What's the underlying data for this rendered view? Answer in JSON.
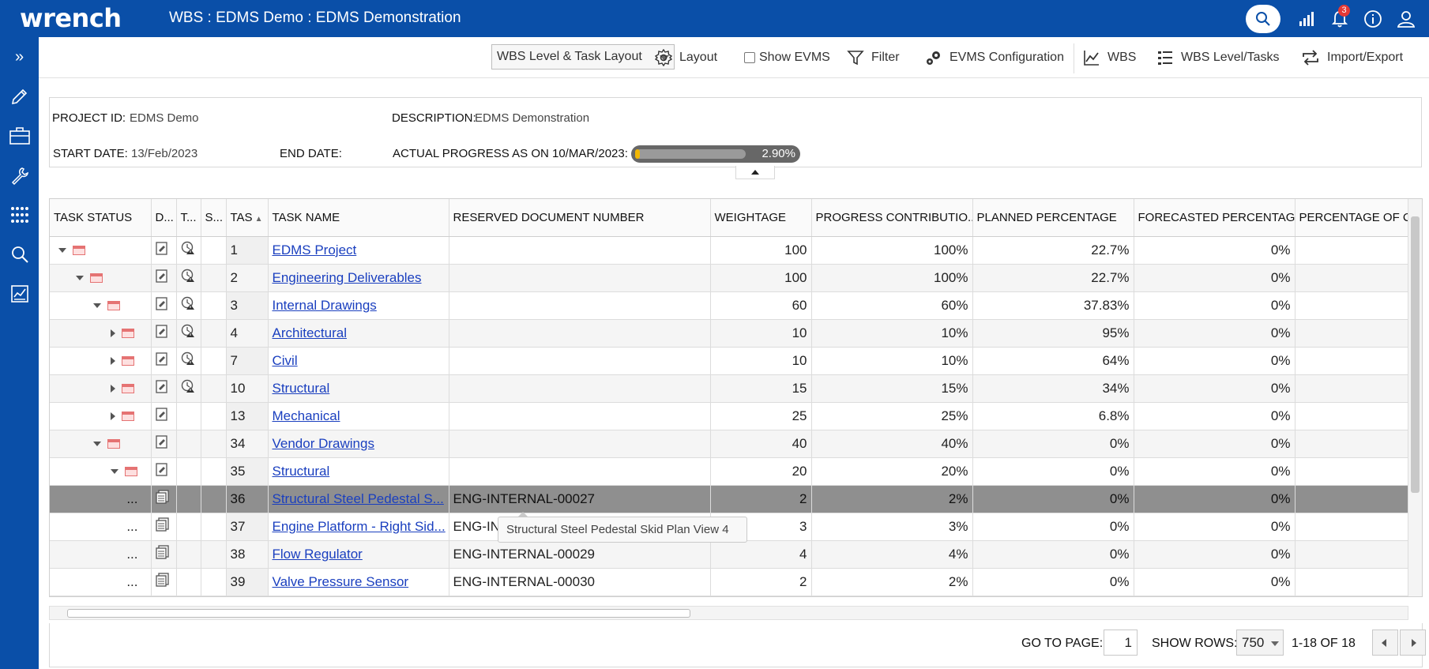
{
  "header": {
    "logo": "wrench",
    "title": "WBS : EDMS Demo : EDMS Demonstration",
    "notification_count": "3",
    "icons": [
      "search-icon",
      "signal-icon",
      "bell-icon",
      "info-icon",
      "user-icon"
    ]
  },
  "sidebar": {
    "expand_label": "»",
    "items": [
      "pencil-icon",
      "briefcase-icon",
      "wrench-icon",
      "grid-icon",
      "search-icon",
      "report-icon"
    ]
  },
  "toolbar": {
    "layout_select": "WBS Level & Task Layout",
    "layout_label": "Layout",
    "show_evms_label": "Show EVMS",
    "filter_label": "Filter",
    "evms_config_label": "EVMS Configuration",
    "wbs_label": "WBS",
    "wbs_level_tasks_label": "WBS Level/Tasks",
    "import_export_label": "Import/Export"
  },
  "project": {
    "project_id_label": "PROJECT ID:",
    "project_id": "EDMS Demo",
    "description_label": "DESCRIPTION:",
    "description": "EDMS Demonstration",
    "start_date_label": "START DATE:",
    "start_date": "13/Feb/2023",
    "end_date_label": "END DATE:",
    "end_date": "",
    "progress_label": "ACTUAL PROGRESS AS ON 10/MAR/2023:",
    "progress_text": "2.90%",
    "progress_value": 0.029
  },
  "grid": {
    "columns": {
      "task_status": "TASK STATUS",
      "d": "D...",
      "t": "T...",
      "s": "S...",
      "task_id": "TAS",
      "task_name": "TASK NAME",
      "reserved_doc": "RESERVED DOCUMENT NUMBER",
      "weightage": "WEIGHTAGE",
      "progress_contribution": "PROGRESS CONTRIBUTIO...",
      "planned": "PLANNED PERCENTAGE",
      "forecasted": "FORECASTED PERCENTAGE",
      "percentage_of": "PERCENTAGE OF C"
    },
    "rows": [
      {
        "id": "1",
        "name": "EDMS Project",
        "doc": "",
        "weight": "100",
        "contrib": "100%",
        "planned": "22.7%",
        "forecast": "0%"
      },
      {
        "id": "2",
        "name": "Engineering Deliverables",
        "doc": "",
        "weight": "100",
        "contrib": "100%",
        "planned": "22.7%",
        "forecast": "0%"
      },
      {
        "id": "3",
        "name": "Internal Drawings",
        "doc": "",
        "weight": "60",
        "contrib": "60%",
        "planned": "37.83%",
        "forecast": "0%"
      },
      {
        "id": "4",
        "name": "Architectural",
        "doc": "",
        "weight": "10",
        "contrib": "10%",
        "planned": "95%",
        "forecast": "0%"
      },
      {
        "id": "7",
        "name": "Civil",
        "doc": "",
        "weight": "10",
        "contrib": "10%",
        "planned": "64%",
        "forecast": "0%"
      },
      {
        "id": "10",
        "name": "Structural",
        "doc": "",
        "weight": "15",
        "contrib": "15%",
        "planned": "34%",
        "forecast": "0%"
      },
      {
        "id": "13",
        "name": "Mechanical",
        "doc": "",
        "weight": "25",
        "contrib": "25%",
        "planned": "6.8%",
        "forecast": "0%"
      },
      {
        "id": "34",
        "name": "Vendor Drawings",
        "doc": "",
        "weight": "40",
        "contrib": "40%",
        "planned": "0%",
        "forecast": "0%"
      },
      {
        "id": "35",
        "name": "Structural",
        "doc": "",
        "weight": "20",
        "contrib": "20%",
        "planned": "0%",
        "forecast": "0%"
      },
      {
        "id": "36",
        "name": "Structural Steel Pedestal S...",
        "doc": "ENG-INTERNAL-00027",
        "weight": "2",
        "contrib": "2%",
        "planned": "0%",
        "forecast": "0%",
        "status": "..."
      },
      {
        "id": "37",
        "name": "Engine Platform - Right Sid...",
        "doc": "ENG-IN",
        "weight": "3",
        "contrib": "3%",
        "planned": "0%",
        "forecast": "0%",
        "status": "..."
      },
      {
        "id": "38",
        "name": "Flow Regulator",
        "doc": "ENG-INTERNAL-00029",
        "weight": "4",
        "contrib": "4%",
        "planned": "0%",
        "forecast": "0%",
        "status": "..."
      },
      {
        "id": "39",
        "name": "Valve Pressure Sensor",
        "doc": "ENG-INTERNAL-00030",
        "weight": "2",
        "contrib": "2%",
        "planned": "0%",
        "forecast": "0%",
        "status": "..."
      }
    ]
  },
  "tooltip": "Structural Steel Pedestal Skid Plan View 4",
  "footer": {
    "go_to_page_label": "GO TO PAGE:",
    "page": "1",
    "show_rows_label": "SHOW ROWS:",
    "rows": "750",
    "range": "1-18 OF 18"
  },
  "colors": {
    "brand": "#0a4fa8",
    "link": "#1a3fbf",
    "progress_fill": "#f2b705",
    "selected_row": "#8f8f8f"
  }
}
